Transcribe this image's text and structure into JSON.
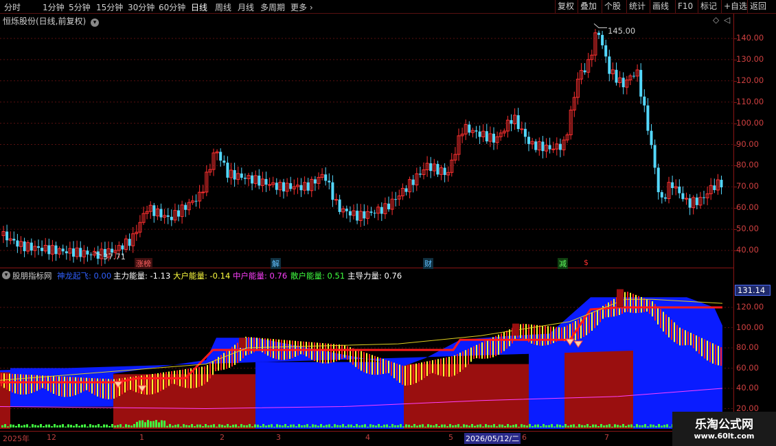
{
  "toolbar": {
    "periods": [
      "分时",
      "1分钟",
      "5分钟",
      "15分钟",
      "30分钟",
      "60分钟",
      "日线",
      "周线",
      "月线",
      "多周期",
      "更多"
    ],
    "active_period": "日线",
    "right_buttons": [
      "复权",
      "叠加",
      "个股",
      "统计",
      "画线",
      "F10",
      "标记",
      "+自选",
      "返回"
    ]
  },
  "price_panel": {
    "title": "恒烁股份(日线,前复权)",
    "high_marker": "145.00",
    "low_marker": "37.71",
    "axis_labels": [
      "140.00",
      "130.00",
      "120.00",
      "110.00",
      "100.00",
      "90.00",
      "80.00",
      "70.00",
      "60.00",
      "50.00",
      "40.00"
    ],
    "event_tags": [
      {
        "text": "涨榜",
        "color": "#ff6060",
        "bg": "#401010"
      },
      {
        "text": "解",
        "color": "#60c0ff",
        "bg": "#103040"
      },
      {
        "text": "财",
        "color": "#60c0ff",
        "bg": "#103040"
      },
      {
        "text": "减",
        "color": "#60ff60",
        "bg": "#104010"
      },
      {
        "text": "$",
        "color": "#ff3030",
        "bg": ""
      }
    ]
  },
  "indicator_panel": {
    "name": "股朋指标网",
    "values": [
      {
        "label": "神龙起飞: 0.00",
        "color": "#3060ff"
      },
      {
        "label": "主力能量: -1.13",
        "color": "#ffffff"
      },
      {
        "label": "大户能量: -0.14",
        "color": "#ffff40"
      },
      {
        "label": "中户能量: 0.76",
        "color": "#ff40ff"
      },
      {
        "label": "散户能量: 0.51",
        "color": "#40ff40"
      },
      {
        "label": "主导力量: 0.76",
        "color": "#ffffff"
      }
    ],
    "current_value": "131.14",
    "axis_labels": [
      "120.00",
      "100.00",
      "80.00",
      "60.00",
      "40.00",
      "20.00"
    ]
  },
  "date_axis": {
    "labels": [
      "2025年",
      "12",
      "1",
      "2",
      "3",
      "4",
      "5",
      "2026/05/12/二",
      "6",
      "7"
    ]
  },
  "watermark": {
    "title": "乐淘公式网",
    "url": "www.60lt.com"
  },
  "colors": {
    "up": "#ff3030",
    "down": "#54d8ff",
    "grid": "#8a1515",
    "axis_text": "#d04040"
  }
}
